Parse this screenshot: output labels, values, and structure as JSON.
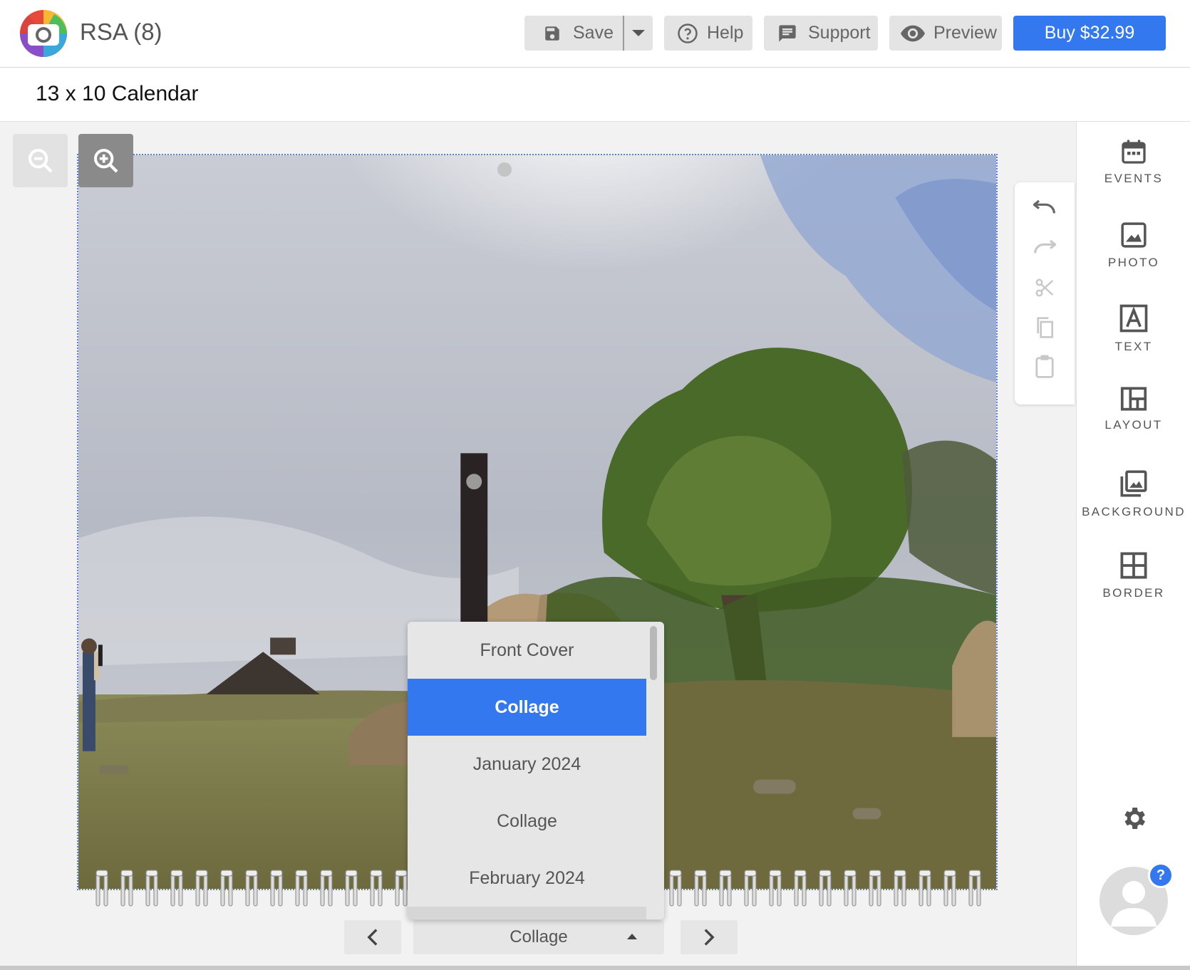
{
  "header": {
    "app_title": "RSA (8)",
    "save_label": "Save",
    "help_label": "Help",
    "support_label": "Support",
    "preview_label": "Preview",
    "buy_label": "Buy $32.99"
  },
  "document": {
    "title": "13 x 10 Calendar"
  },
  "sidebar": {
    "items": [
      {
        "label": "EVENTS",
        "icon": "calendar-icon"
      },
      {
        "label": "PHOTO",
        "icon": "photo-icon"
      },
      {
        "label": "TEXT",
        "icon": "text-icon"
      },
      {
        "label": "LAYOUT",
        "icon": "layout-icon"
      },
      {
        "label": "BACKGROUND",
        "icon": "background-icon"
      },
      {
        "label": "BORDER",
        "icon": "border-icon"
      }
    ],
    "help_badge": "?"
  },
  "page_nav": {
    "current_page": "Collage",
    "options": [
      "Front Cover",
      "Collage",
      "January 2024",
      "Collage",
      "February 2024"
    ],
    "selected_index": 1
  },
  "colors": {
    "accent": "#3478f0",
    "button_bg": "#e4e4e4"
  }
}
